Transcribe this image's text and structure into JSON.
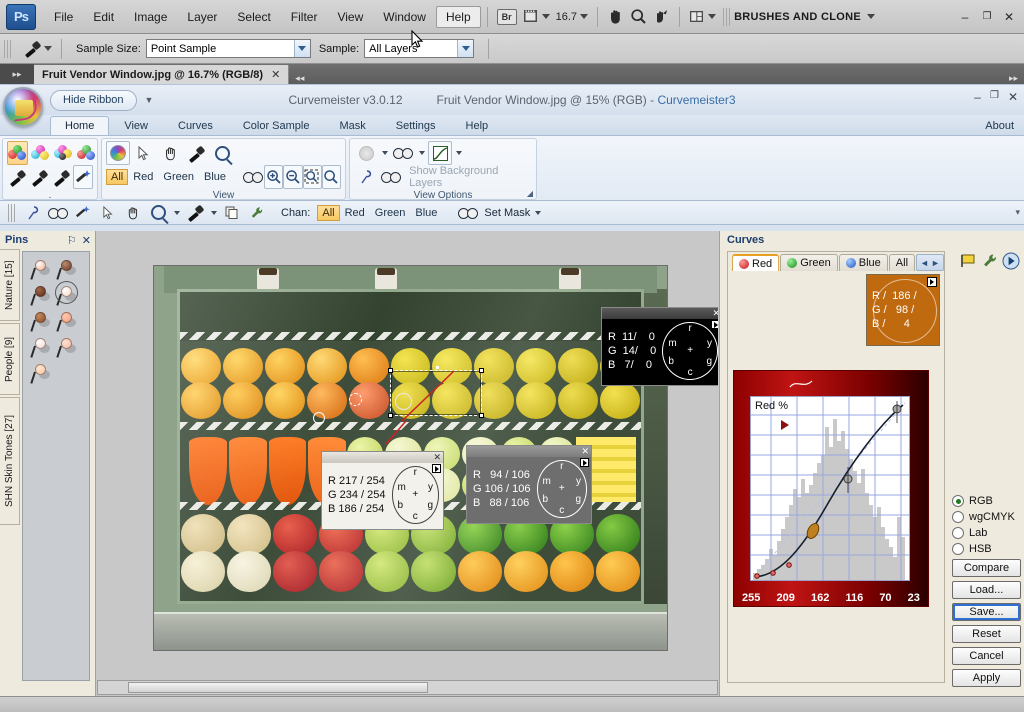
{
  "photoshop": {
    "logo": "Ps",
    "menus": [
      {
        "label": "File",
        "active": false
      },
      {
        "label": "Edit",
        "active": false
      },
      {
        "label": "Image",
        "active": false
      },
      {
        "label": "Layer",
        "active": false
      },
      {
        "label": "Select",
        "active": false
      },
      {
        "label": "Filter",
        "active": false
      },
      {
        "label": "View",
        "active": false
      },
      {
        "label": "Window",
        "active": false
      },
      {
        "label": "Help",
        "active": true
      }
    ],
    "bridge_label": "Br",
    "zoom_level": "16.7",
    "workspace": "BRUSHES AND CLONE",
    "window_buttons": {
      "minimize": "–",
      "restore": "❐",
      "close": "✕"
    },
    "options_bar": {
      "sample_size_label": "Sample Size:",
      "sample_size_value": "Point Sample",
      "sample_label": "Sample:",
      "sample_value": "All Layers"
    },
    "document_tab": {
      "title": "Fruit Vendor Window.jpg @ 16.7% (RGB/8)",
      "close": "✕"
    }
  },
  "curvemeister": {
    "hide_ribbon_label": "Hide Ribbon",
    "app_title": "Curvemeister v3.0.12",
    "document_title": "Fruit Vendor Window.jpg @ 15% (RGB)  -  ",
    "document_app": "Curvemeister3",
    "about_label": "About",
    "window_buttons": {
      "minimize": "–",
      "restore": "❐",
      "close": "✕"
    },
    "ribbon_tabs": [
      {
        "label": "Home",
        "active": true
      },
      {
        "label": "View",
        "active": false
      },
      {
        "label": "Curves",
        "active": false
      },
      {
        "label": "Color Sample",
        "active": false
      },
      {
        "label": "Mask",
        "active": false
      },
      {
        "label": "Settings",
        "active": false
      },
      {
        "label": "Help",
        "active": false
      }
    ],
    "ribbon_groups": [
      {
        "title": ".",
        "name": "color-space-group"
      },
      {
        "title": "View",
        "name": "view-group"
      },
      {
        "title": "View Options",
        "name": "view-options-group"
      }
    ],
    "view_group": {
      "channels": [
        {
          "label": "All",
          "active": true
        },
        {
          "label": "Red",
          "active": false
        },
        {
          "label": "Green",
          "active": false
        },
        {
          "label": "Blue",
          "active": false
        }
      ]
    },
    "view_options": {
      "show_background_layers": "Show Background Layers"
    },
    "toolbar2": {
      "chan_label": "Chan:",
      "channels": [
        {
          "label": "All",
          "active": true
        },
        {
          "label": "Red",
          "active": false
        },
        {
          "label": "Green",
          "active": false
        },
        {
          "label": "Blue",
          "active": false
        }
      ],
      "set_mask_label": "Set Mask"
    }
  },
  "pins_panel": {
    "title": "Pins",
    "pin_icon": "⚐",
    "close_icon": "✕",
    "tabs": [
      {
        "label": "Nature [15]",
        "active": false
      },
      {
        "label": "People [9]",
        "active": false
      },
      {
        "label": "SHN Skin Tones [27]",
        "active": false
      }
    ],
    "pins": [
      {
        "color": "#f0b08c",
        "selected": false
      },
      {
        "color": "#6b3a24",
        "selected": false
      },
      {
        "color": "#5a2a18",
        "selected": false
      },
      {
        "color": "#f7d8c4",
        "selected": true
      },
      {
        "color": "#8a4a28",
        "selected": false
      },
      {
        "color": "#f0a080",
        "selected": false
      },
      {
        "color": "#f6d7cc",
        "selected": false
      },
      {
        "color": "#f5bfa8",
        "selected": false
      },
      {
        "color": "#f9c8a8",
        "selected": false
      }
    ]
  },
  "readouts": [
    {
      "name": "readout-dark",
      "style": "dark",
      "lines": "R  11/    0\nG  14/    0\nB   7/    0",
      "close": "✕",
      "wheel": {
        "r": "r",
        "y": "y",
        "g": "g",
        "c": "c",
        "b": "b",
        "m": "m",
        "center": "+"
      }
    },
    {
      "name": "readout-light",
      "style": "light",
      "lines": "R 217 / 254\nG 234 / 254\nB 186 / 254",
      "close": "✕",
      "wheel": {
        "r": "r",
        "y": "y",
        "g": "g",
        "c": "c",
        "b": "b",
        "m": "m",
        "center": "+"
      }
    },
    {
      "name": "readout-gray",
      "style": "gray",
      "lines": "R   94 / 106\nG 106 / 106\nB   88 / 106",
      "close": "✕",
      "wheel": {
        "r": "r",
        "y": "y",
        "g": "g",
        "c": "c",
        "b": "b",
        "m": "m",
        "center": "+"
      }
    }
  ],
  "curves_panel": {
    "title": "Curves",
    "channel_tabs": [
      {
        "label": "Red",
        "color": "#d8322d",
        "active": true
      },
      {
        "label": "Green",
        "color": "#3aa53a",
        "active": false
      },
      {
        "label": "Blue",
        "color": "#3a7fd5",
        "active": false
      },
      {
        "label": "All",
        "color": "",
        "active": false
      }
    ],
    "nav_prev": "◄",
    "nav_next": "►",
    "swatch": {
      "lines": "R /  186 /\nG /   98 /\nB /      4",
      "color": "#c06a10",
      "r": 186,
      "g": 98,
      "b": 4
    },
    "plot": {
      "label": "Red %",
      "axis_ticks": [
        "255",
        "209",
        "162",
        "116",
        "70",
        "23"
      ]
    },
    "color_modes": [
      {
        "label": "RGB",
        "selected": true
      },
      {
        "label": "wgCMYK",
        "selected": false
      },
      {
        "label": "Lab",
        "selected": false
      },
      {
        "label": "HSB",
        "selected": false
      }
    ],
    "buttons": [
      {
        "label": "Compare",
        "focused": false
      },
      {
        "label": "Load...",
        "focused": false
      },
      {
        "label": "Save...",
        "focused": true
      },
      {
        "label": "Reset",
        "focused": false
      },
      {
        "label": "Cancel",
        "focused": false
      },
      {
        "label": "Apply",
        "focused": false
      }
    ]
  },
  "chart_data": {
    "type": "line",
    "title": "Red %",
    "xlabel": "",
    "ylabel": "",
    "axis_ticks_x": [
      255,
      209,
      162,
      116,
      70,
      23
    ],
    "grid": true,
    "series": [
      {
        "name": "Red curve",
        "x": [
          0,
          10,
          20,
          30,
          40,
          50,
          60,
          70,
          80,
          90,
          100
        ],
        "y": [
          0,
          1,
          3,
          7,
          14,
          24,
          37,
          52,
          67,
          83,
          98
        ]
      },
      {
        "name": "Identity (dashed)",
        "x": [
          0,
          100
        ],
        "y": [
          0,
          100
        ]
      }
    ],
    "histogram": {
      "name": "Red channel histogram",
      "bins": [
        4,
        6,
        5,
        9,
        12,
        10,
        14,
        20,
        26,
        30,
        38,
        34,
        44,
        52,
        46,
        58,
        70,
        62,
        78,
        88,
        74,
        92,
        80,
        66,
        58,
        48,
        40,
        34,
        26,
        22,
        18,
        14,
        10,
        8,
        30
      ]
    },
    "control_points": [
      {
        "x": 3,
        "y": 1
      },
      {
        "x": 12,
        "y": 4
      },
      {
        "x": 22,
        "y": 9
      },
      {
        "x": 38,
        "y": 22
      },
      {
        "x": 62,
        "y": 55
      },
      {
        "x": 95,
        "y": 96
      }
    ]
  }
}
